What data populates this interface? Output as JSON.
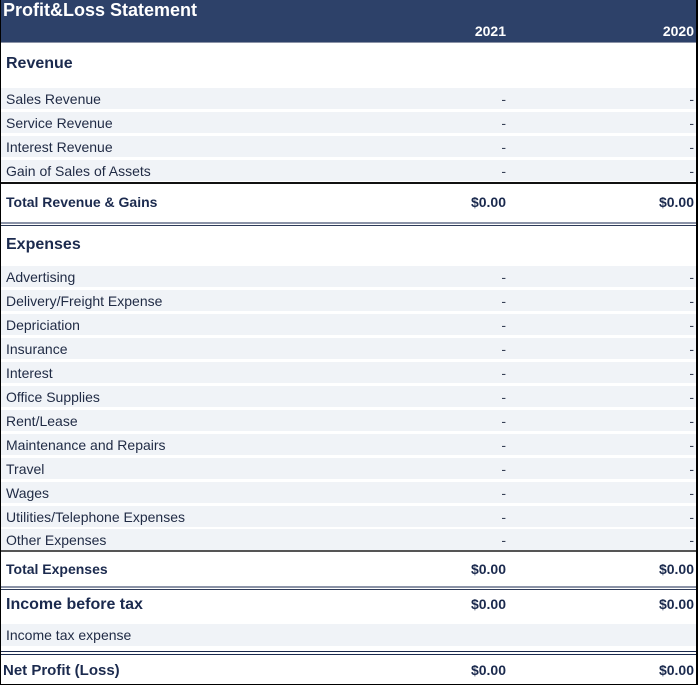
{
  "header": {
    "title": "Profit&Loss Statement",
    "years": [
      "2021",
      "2020"
    ]
  },
  "revenue": {
    "heading": "Revenue",
    "items": [
      {
        "label": "Sales Revenue",
        "v2021": "-",
        "v2020": "-"
      },
      {
        "label": "Service Revenue",
        "v2021": "-",
        "v2020": "-"
      },
      {
        "label": "Interest Revenue",
        "v2021": "-",
        "v2020": "-"
      },
      {
        "label": "Gain of Sales of Assets",
        "v2021": "-",
        "v2020": "-"
      }
    ],
    "total": {
      "label": "Total Revenue & Gains",
      "v2021": "$0.00",
      "v2020": "$0.00"
    }
  },
  "expenses": {
    "heading": "Expenses",
    "items": [
      {
        "label": "Advertising",
        "v2021": "-",
        "v2020": "-"
      },
      {
        "label": "Delivery/Freight Expense",
        "v2021": "-",
        "v2020": "-"
      },
      {
        "label": "Depriciation",
        "v2021": "-",
        "v2020": "-"
      },
      {
        "label": "Insurance",
        "v2021": "-",
        "v2020": "-"
      },
      {
        "label": "Interest",
        "v2021": "-",
        "v2020": "-"
      },
      {
        "label": "Office Supplies",
        "v2021": "-",
        "v2020": "-"
      },
      {
        "label": "Rent/Lease",
        "v2021": "-",
        "v2020": "-"
      },
      {
        "label": "Maintenance and Repairs",
        "v2021": "-",
        "v2020": "-"
      },
      {
        "label": "Travel",
        "v2021": "-",
        "v2020": "-"
      },
      {
        "label": "Wages",
        "v2021": "-",
        "v2020": "-"
      },
      {
        "label": "Utilities/Telephone Expenses",
        "v2021": "-",
        "v2020": "-"
      },
      {
        "label": "Other Expenses",
        "v2021": "-",
        "v2020": "-"
      }
    ],
    "total": {
      "label": "Total Expenses",
      "v2021": "$0.00",
      "v2020": "$0.00"
    }
  },
  "income_before_tax": {
    "label": "Income before tax",
    "v2021": "$0.00",
    "v2020": "$0.00"
  },
  "income_tax": {
    "label": "Income tax expense",
    "v2021": "",
    "v2020": ""
  },
  "net_profit": {
    "label": "Net Profit (Loss)",
    "v2021": "$0.00",
    "v2020": "$0.00"
  },
  "colors": {
    "header_bg": "#2d4169",
    "row_bg": "#f0f3f7",
    "text": "#1b2a4e"
  }
}
